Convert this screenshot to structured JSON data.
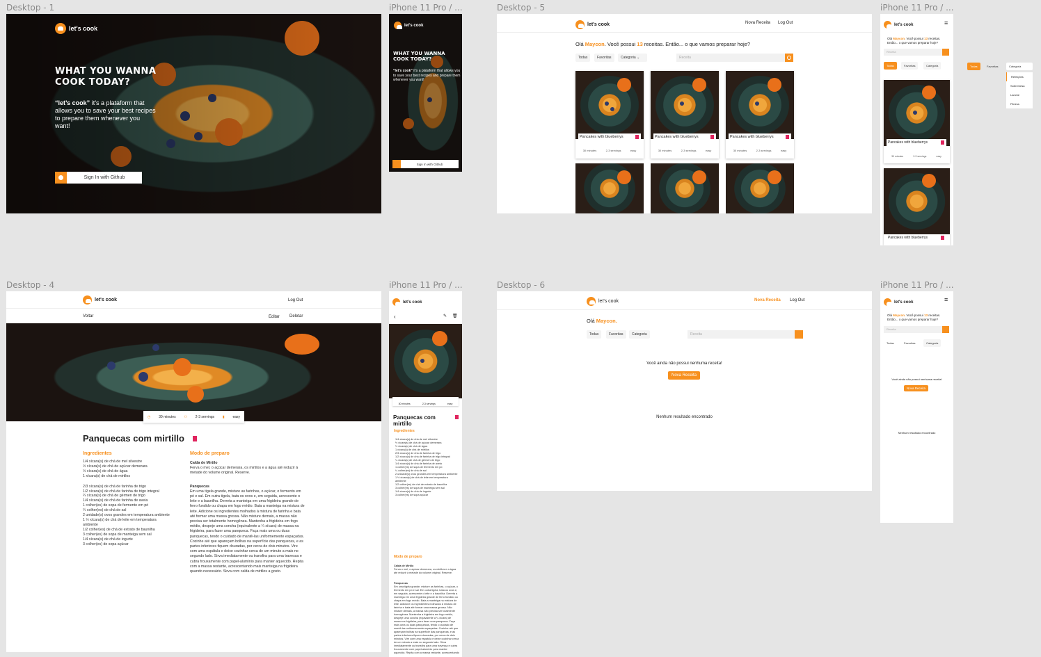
{
  "frames": {
    "d1": "Desktop - 1",
    "m1": "iPhone 11 Pro / ...",
    "d5": "Desktop - 5",
    "m5": "iPhone 11 Pro / ...",
    "d4": "Desktop - 4",
    "m4": "iPhone 11 Pro / ...",
    "d6": "Desktop - 6",
    "m6": "iPhone 11 Pro / ..."
  },
  "brand": "let's cook",
  "landing": {
    "headline": "WHAT YOU WANNA COOK TODAY?",
    "tagline_strong": "“let’s cook”",
    "tagline_rest": " it’s a plataform that allows you to save your best recipes to prepare them whenever you want!",
    "mobile_tagline_rest": " it’s a plataform that allows you to save your best recipes and prepare them whenever you want!",
    "github_button": "Sign In with Github"
  },
  "nav": {
    "new_recipe": "Nova Receita",
    "logout": "Log Out"
  },
  "greeting": {
    "prefix": "Olá ",
    "name": "Maycon",
    "mid": ". Você possui ",
    "count": "13",
    "suffix": " receitas. Então... o que vamos preparar hoje?",
    "name_only": "Maycon."
  },
  "filters": {
    "all": "Todas",
    "favorites": "Favoritas",
    "category": "Categoria",
    "search_placeholder": "Receita",
    "category_options": [
      "Refeições",
      "Sobremesa",
      "Lanche",
      "Fitness"
    ]
  },
  "card": {
    "title": "Pancakes with blueberrys",
    "time": "30 minutes",
    "servings": "2-3 servings",
    "difficulty": "easy"
  },
  "recipe": {
    "back": "Voltar",
    "edit": "Editar",
    "delete": "Deletar",
    "title": "Panquecas com mirtillo",
    "ingredients_title": "Ingredientes",
    "method_title": "Modo de preparo",
    "ingredients": [
      "1/4 xícara(s) de chá de mel silvestre",
      "½ xícara(s) de chá de açúcar demerara",
      "½ xícara(s) de chá de água",
      "1 xícara(s) de chá de mirtilos",
      "",
      "2/3 xícara(s) de chá de farinha de trigo",
      "1/2 xícara(s) de chá de farinha de trigo integral",
      "¼ xícara(s) de chá de gérmen de trigo",
      "1/4 xícara(s) de chá de farinha de aveia",
      "1 colher(es) de sopa de fermento em pó",
      "¼ colher(es) de chá de sal",
      "2 unidade(s) ovos grandes em temperatura ambiente",
      "1 ½ xícara(s) de chá de leite em temperatura ambiente",
      "1/2 colher(es) de chá de extrato de baunilha",
      "3 colher(es) de sopa de manteiga sem sal",
      "1/4 xícara(s) de chá de iogurte",
      "3 colher(es) de sopa açúcar"
    ],
    "method_sub1": "Calda de Mirtilo",
    "method_p1": "Ferva o mel, o açúcar demerara, os mirtilos e a água até reduzir à metade do volume original. Reserve.",
    "method_sub2": "Panquecas",
    "method_p2": "Em uma tigela grande, misture as farinhas, o açúcar, o fermento em pó e sal. Em outra tigela, bata os ovos e, em seguida, acrescente o leite e a baunilha. Derreta a manteiga em uma frigideira grande de ferro fundido ou chapa em fogo médio. Bata a manteiga na mistura de leite. Adicione os ingredientes molhados à mistura de farinha e bata até formar uma massa grossa. Não misture demais, a massa não precisa ser totalmente homogênea. Mantenha a frigideira em fogo médio, despeje uma concha (equivalente a ¼ xícara) de massa na frigideira, para fazer uma panqueca. Faça mais uma ou duas panquecas, tendo o cuidado de mantê-las uniformemente espaçadas. Cozinhe até que apareçam bolhas na superfície das panquecas, e as partes inferiores fiquem douradas, por cerca de dois minutos. Vire com uma espátula e deixe cozinhar cerca de um minuto a mais no segundo lado. Sirva imediatamente ou transfira para uma travessa e cubra frouxamente com papel-alumínio para manter aquecido. Repita com a massa restante, acrescentando mais manteiga na frigideira quando necessário. Sirva com calda de mirtilos a gosto."
  },
  "empty": {
    "no_recipes": "Você ainda não possui nenhuma receita!",
    "new_recipe_button": "Nova Receita",
    "no_results": "Nenhum resultado encontrado"
  }
}
